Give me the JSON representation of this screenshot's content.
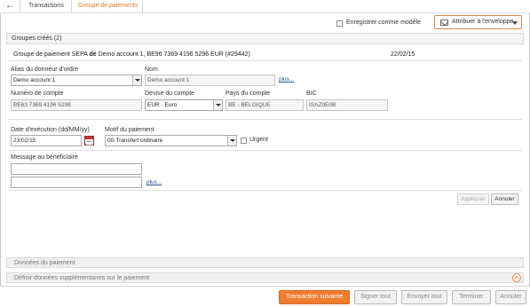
{
  "breadcrumb": {
    "items": [
      "Transactions",
      "Groupe de paiements"
    ]
  },
  "header": {
    "save_model_label": "Enregistrer comme modèle",
    "envelope_label": "Attribuer à l'enveloppe"
  },
  "groups": {
    "label": "Groupes créés (2)"
  },
  "group": {
    "title_prefix": "Groupe de paiement SEPA ",
    "title_bold": "de",
    "title_suffix": " Demo account 1, BE96 7369 4196 5296 EUR (#29442)",
    "date": "22/02/15"
  },
  "form": {
    "alias_label": "Alias du donneur d'ordre",
    "alias_value": "Demo account 1",
    "name_label": "Nom",
    "name_value": "Demo account 1",
    "more_link": "plus...",
    "account_label": "Numéro de compte",
    "account_value": "BE63 7369 4196 5298",
    "currency_label": "Devise du compte",
    "currency_value": "EUR - Euro",
    "country_label": "Pays du compte",
    "country_value": "BE - BELGIQUE",
    "bic_label": "BIC",
    "bic_value": "ISAZ0E0B",
    "exec_date_label": "Date d'exécution (dd/MM/yy)",
    "exec_date_value": "23/02/15",
    "reason_label": "Motif du paiement",
    "reason_value": "00-Transfert ordinaire",
    "urgent_label": "Urgent",
    "message_label": "Message au bénéficiaire",
    "message_line1": "",
    "message_line2": "",
    "message_more_link": "plus...",
    "apply_label": "Appliquer",
    "cancel_label": "Annuler"
  },
  "panels": {
    "payment_data_label": "Données du paiement",
    "extra_data_label": "Définir données supplémentaires sur le paiement"
  },
  "footer": {
    "next_label": "Transaction suivante",
    "sign_all_label": "Signer tout",
    "send_all_label": "Envoyer tout",
    "finish_label": "Terminer",
    "cancel_label": "Annuler"
  },
  "colors": {
    "accent": "#ee7d2f",
    "link": "#2a4f9c"
  }
}
